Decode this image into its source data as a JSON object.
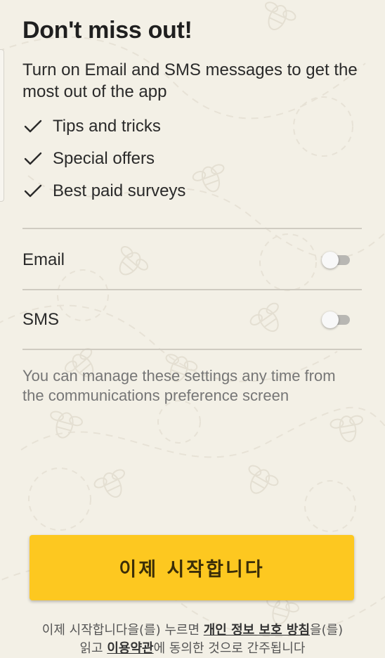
{
  "header": {
    "title": "Don't miss out!",
    "subtitle": "Turn on Email and SMS messages to get the most out of the app"
  },
  "benefits": [
    {
      "label": "Tips and tricks",
      "icon": "checkmark-icon"
    },
    {
      "label": "Special offers",
      "icon": "checkmark-icon"
    },
    {
      "label": "Best paid surveys",
      "icon": "checkmark-icon"
    }
  ],
  "settings": {
    "email": {
      "label": "Email",
      "enabled": false
    },
    "sms": {
      "label": "SMS",
      "enabled": false
    }
  },
  "note": "You can manage these settings any time from the communications preference screen",
  "cta": {
    "label": "이제 시작합니다"
  },
  "legal": {
    "line1_prefix": "이제 시작합니다을(를) 누르면 ",
    "privacy_link": "개인 정보 보호 방침",
    "line1_suffix": "을(를)",
    "line2_prefix": "읽고 ",
    "terms_link": "이용약관",
    "line2_suffix": "에 동의한 것으로 간주됩니다"
  },
  "colors": {
    "background": "#f3f0e6",
    "accent": "#fdc820",
    "toggle_off_track": "#b8b7b3",
    "divider": "#cfcbc1",
    "muted_text": "#767676"
  },
  "background_pattern": "bee-doodle-pattern"
}
